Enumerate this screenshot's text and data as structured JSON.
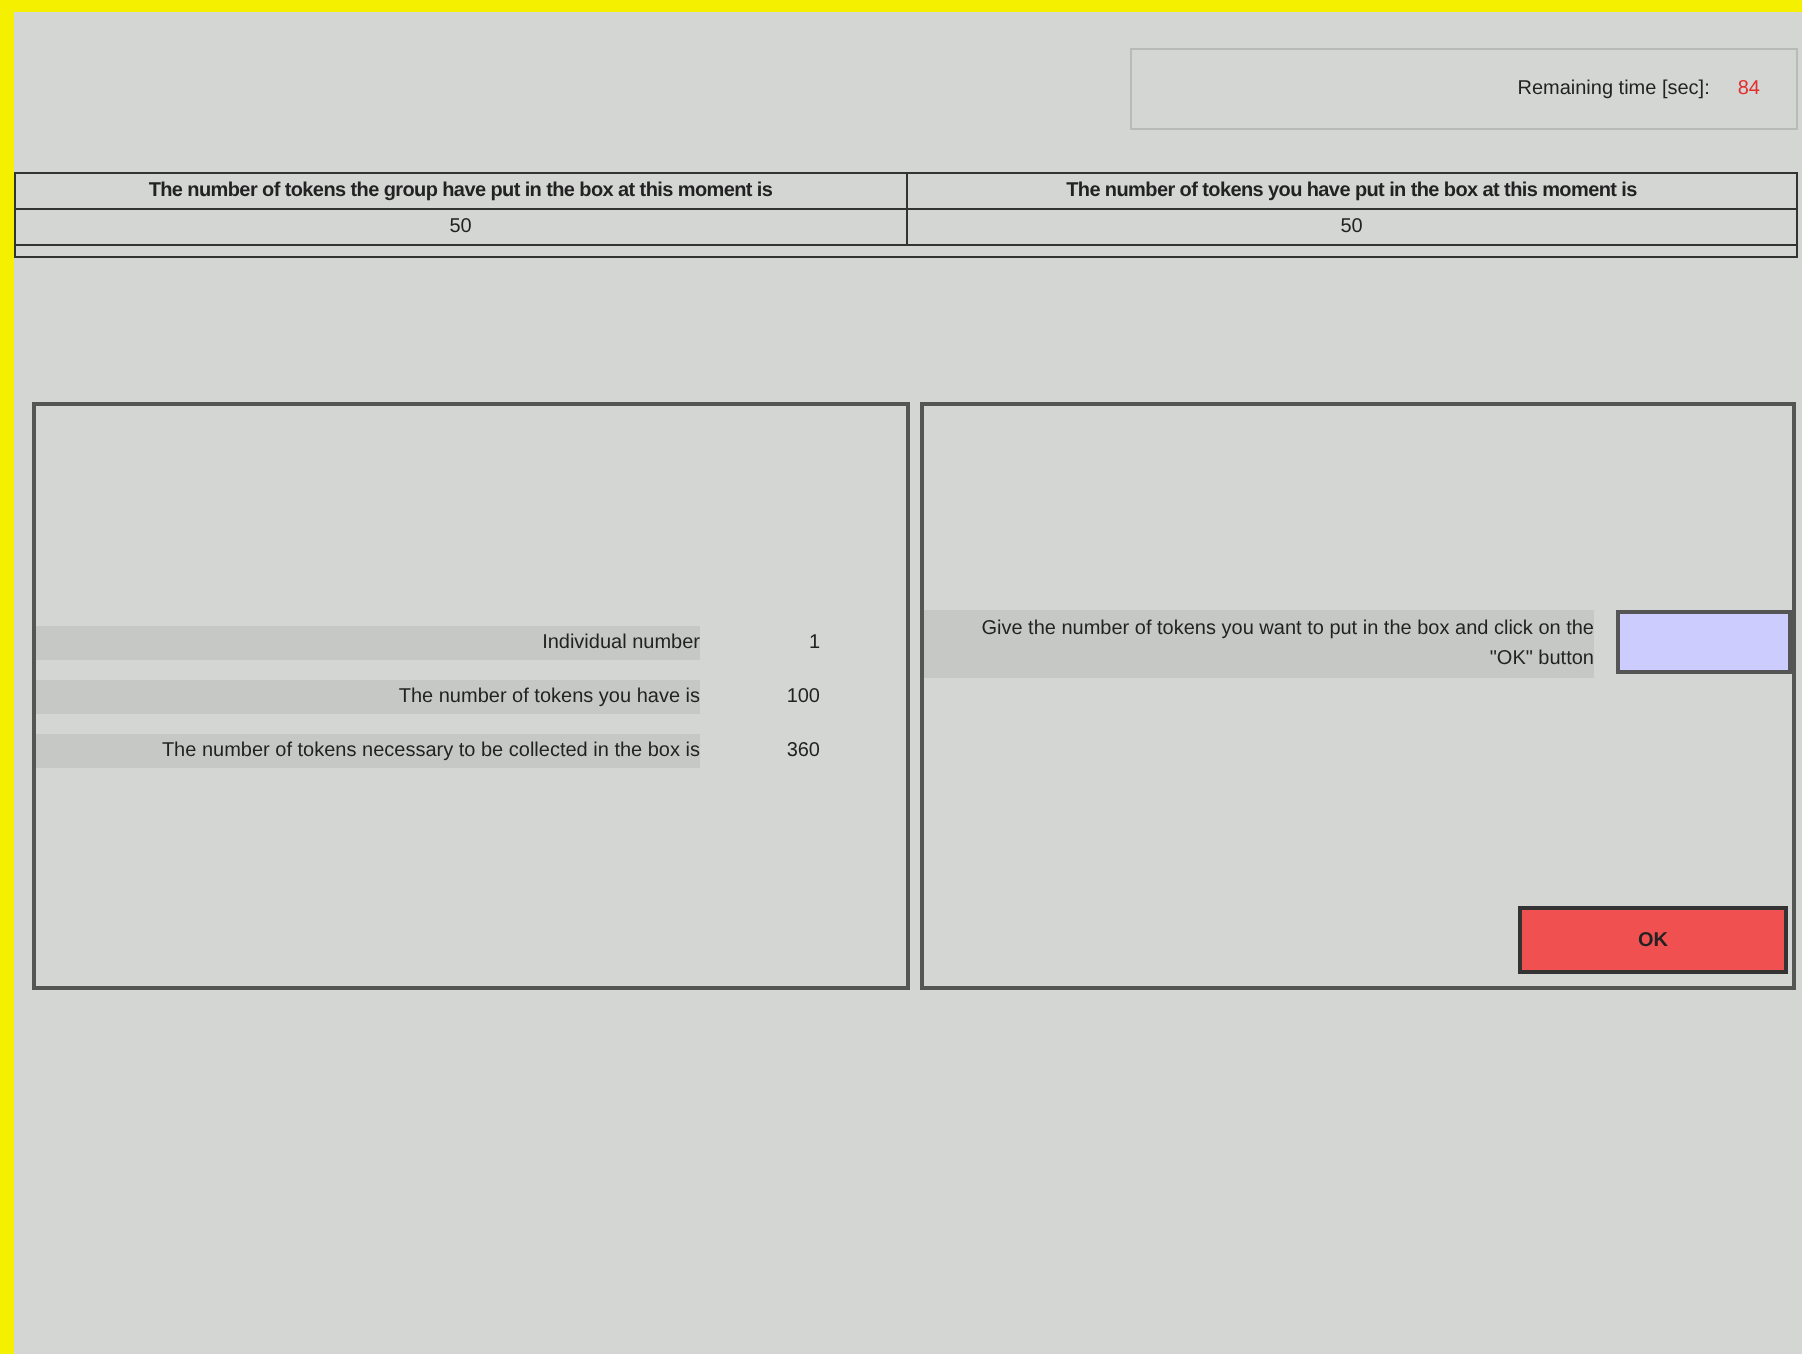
{
  "timer": {
    "label": "Remaining time [sec]:",
    "value": "84"
  },
  "table": {
    "columns": [
      "The number of tokens the group have put in the box at this moment is",
      "The number of tokens you have put in the box at this moment is"
    ],
    "rows": [
      [
        "50",
        "50"
      ]
    ]
  },
  "info": [
    {
      "label": "Individual number",
      "value": "1"
    },
    {
      "label": "The number of tokens you have is",
      "value": "100"
    },
    {
      "label": "The number of tokens necessary to be collected in the box is",
      "value": "360"
    }
  ],
  "entry": {
    "prompt": "Give the number of tokens you want to put in the box and click on the \"OK\" button"
  },
  "ok_button": "OK"
}
